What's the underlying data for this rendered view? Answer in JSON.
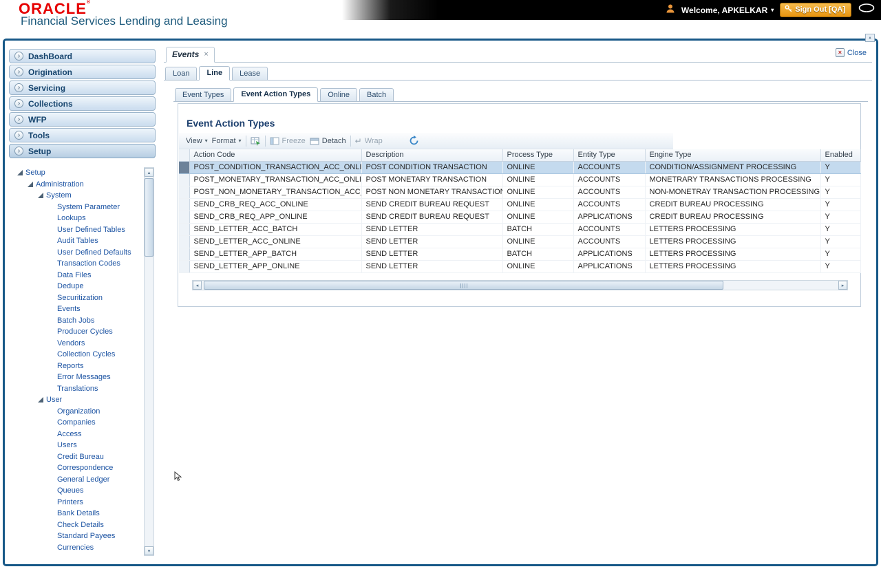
{
  "header": {
    "logo_text": "ORACLE",
    "subtitle": "Financial Services Lending and Leasing",
    "welcome_text": "Welcome, APKELKAR",
    "sign_out_label": "Sign Out [QA]"
  },
  "icons": {
    "chevron_right": "›",
    "caret_down": "▾",
    "close_x": "×",
    "arrow_up": "▴",
    "arrow_down": "▾",
    "arrow_left": "◂",
    "arrow_right": "▸",
    "wrap_return": "↵"
  },
  "sidebar": {
    "menu_items": [
      {
        "label": "DashBoard"
      },
      {
        "label": "Origination"
      },
      {
        "label": "Servicing"
      },
      {
        "label": "Collections"
      },
      {
        "label": "WFP"
      },
      {
        "label": "Tools"
      },
      {
        "label": "Setup",
        "active": true
      }
    ],
    "tree": [
      {
        "label": "Setup",
        "level": 0,
        "expandable": true
      },
      {
        "label": "Administration",
        "level": 1,
        "expandable": true
      },
      {
        "label": "System",
        "level": 2,
        "expandable": true
      },
      {
        "label": "System Parameter",
        "level": 3
      },
      {
        "label": "Lookups",
        "level": 3
      },
      {
        "label": "User Defined Tables",
        "level": 3
      },
      {
        "label": "Audit Tables",
        "level": 3
      },
      {
        "label": "User Defined Defaults",
        "level": 3
      },
      {
        "label": "Transaction Codes",
        "level": 3
      },
      {
        "label": "Data Files",
        "level": 3
      },
      {
        "label": "Dedupe",
        "level": 3
      },
      {
        "label": "Securitization",
        "level": 3
      },
      {
        "label": "Events",
        "level": 3
      },
      {
        "label": "Batch Jobs",
        "level": 3
      },
      {
        "label": "Producer Cycles",
        "level": 3
      },
      {
        "label": "Vendors",
        "level": 3
      },
      {
        "label": "Collection Cycles",
        "level": 3
      },
      {
        "label": "Reports",
        "level": 3
      },
      {
        "label": "Error Messages",
        "level": 3
      },
      {
        "label": "Translations",
        "level": 3
      },
      {
        "label": "User",
        "level": 2,
        "expandable": true
      },
      {
        "label": "Organization",
        "level": 3
      },
      {
        "label": "Companies",
        "level": 3
      },
      {
        "label": "Access",
        "level": 3
      },
      {
        "label": "Users",
        "level": 3
      },
      {
        "label": "Credit Bureau",
        "level": 3
      },
      {
        "label": "Correspondence",
        "level": 3
      },
      {
        "label": "General Ledger",
        "level": 3
      },
      {
        "label": "Queues",
        "level": 3
      },
      {
        "label": "Printers",
        "level": 3
      },
      {
        "label": "Bank Details",
        "level": 3
      },
      {
        "label": "Check Details",
        "level": 3
      },
      {
        "label": "Standard Payees",
        "level": 3
      },
      {
        "label": "Currencies",
        "level": 3
      }
    ]
  },
  "workspace": {
    "doc_tab_label": "Events",
    "close_label": "Close",
    "product_tabs": [
      {
        "label": "Loan"
      },
      {
        "label": "Line",
        "active": true
      },
      {
        "label": "Lease"
      }
    ],
    "sub_tabs": [
      {
        "label": "Event Types"
      },
      {
        "label": "Event Action Types",
        "active": true
      },
      {
        "label": "Online"
      },
      {
        "label": "Batch"
      }
    ],
    "panel": {
      "title": "Event Action Types",
      "toolbar": {
        "view_label": "View",
        "format_label": "Format",
        "freeze_label": "Freeze",
        "detach_label": "Detach",
        "wrap_label": "Wrap"
      },
      "table": {
        "columns": [
          "Action Code",
          "Description",
          "Process Type",
          "Entity Type",
          "Engine Type",
          "Enabled"
        ],
        "rows": [
          {
            "code": "POST_CONDITION_TRANSACTION_ACC_ONLINE",
            "desc": "POST CONDITION TRANSACTION",
            "process": "ONLINE",
            "entity": "ACCOUNTS",
            "engine": "CONDITION/ASSIGNMENT PROCESSING",
            "enabled": "Y",
            "selected": true
          },
          {
            "code": "POST_MONETARY_TRANSACTION_ACC_ONLINE",
            "desc": "POST MONETARY TRANSACTION",
            "process": "ONLINE",
            "entity": "ACCOUNTS",
            "engine": "MONETRARY TRANSACTIONS PROCESSING",
            "enabled": "Y"
          },
          {
            "code": "POST_NON_MONETARY_TRANSACTION_ACC_ON...",
            "desc": "POST NON MONETARY TRANSACTION",
            "process": "ONLINE",
            "entity": "ACCOUNTS",
            "engine": "NON-MONETRAY TRANSACTION PROCESSING",
            "enabled": "Y"
          },
          {
            "code": "SEND_CRB_REQ_ACC_ONLINE",
            "desc": "SEND CREDIT BUREAU REQUEST",
            "process": "ONLINE",
            "entity": "ACCOUNTS",
            "engine": "CREDIT BUREAU PROCESSING",
            "enabled": "Y"
          },
          {
            "code": "SEND_CRB_REQ_APP_ONLINE",
            "desc": "SEND CREDIT BUREAU REQUEST",
            "process": "ONLINE",
            "entity": "APPLICATIONS",
            "engine": "CREDIT BUREAU PROCESSING",
            "enabled": "Y"
          },
          {
            "code": "SEND_LETTER_ACC_BATCH",
            "desc": "SEND LETTER",
            "process": "BATCH",
            "entity": "ACCOUNTS",
            "engine": "LETTERS PROCESSING",
            "enabled": "Y"
          },
          {
            "code": "SEND_LETTER_ACC_ONLINE",
            "desc": "SEND LETTER",
            "process": "ONLINE",
            "entity": "ACCOUNTS",
            "engine": "LETTERS PROCESSING",
            "enabled": "Y"
          },
          {
            "code": "SEND_LETTER_APP_BATCH",
            "desc": "SEND LETTER",
            "process": "BATCH",
            "entity": "APPLICATIONS",
            "engine": "LETTERS PROCESSING",
            "enabled": "Y"
          },
          {
            "code": "SEND_LETTER_APP_ONLINE",
            "desc": "SEND LETTER",
            "process": "ONLINE",
            "entity": "APPLICATIONS",
            "engine": "LETTERS PROCESSING",
            "enabled": "Y"
          }
        ]
      }
    }
  }
}
